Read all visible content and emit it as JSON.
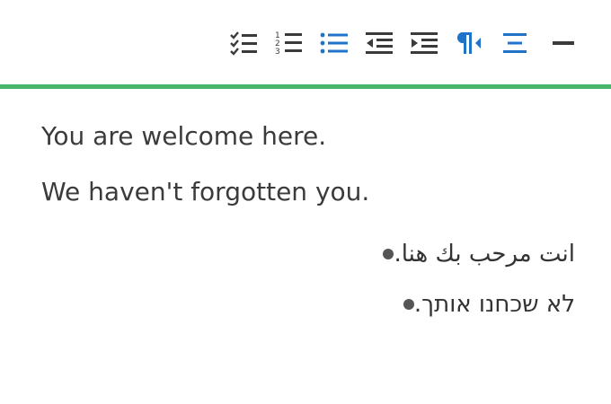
{
  "toolbar": {
    "accent_color": "#48b66c",
    "active_color": "#1f74c9",
    "icon_color": "#3a3a3a",
    "buttons": [
      {
        "icon": "checklist-icon",
        "state": "inactive"
      },
      {
        "icon": "numbered-list-icon",
        "state": "inactive"
      },
      {
        "icon": "bulleted-list-icon",
        "state": "active"
      },
      {
        "icon": "outdent-icon",
        "state": "inactive"
      },
      {
        "icon": "indent-icon",
        "state": "inactive"
      },
      {
        "icon": "rtl-paragraph-icon",
        "state": "active"
      },
      {
        "icon": "align-center-icon",
        "state": "active"
      },
      {
        "icon": "minus-icon",
        "state": "inactive"
      }
    ],
    "numbered_marks": [
      "1",
      "2",
      "3"
    ]
  },
  "editor": {
    "paragraphs": [
      "You are welcome here.",
      "We haven't forgotten you."
    ],
    "rtl_list": [
      "انت مرحب بك هنا.",
      "לא שכחנו אותך."
    ]
  }
}
